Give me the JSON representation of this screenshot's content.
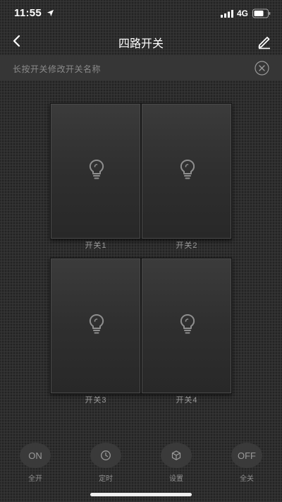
{
  "status_bar": {
    "time": "11:55",
    "network": "4G",
    "icons": [
      "location-arrow-icon",
      "signal-icon",
      "battery-icon"
    ]
  },
  "nav": {
    "title": "四路开关",
    "back_icon": "chevron-left-icon",
    "edit_icon": "pencil-icon"
  },
  "hint": {
    "text": "长按开关修改开关名称",
    "close_icon": "close-circle-icon"
  },
  "switches": [
    {
      "label": "开关1",
      "icon": "bulb-icon"
    },
    {
      "label": "开关2",
      "icon": "bulb-icon"
    },
    {
      "label": "开关3",
      "icon": "bulb-icon"
    },
    {
      "label": "开关4",
      "icon": "bulb-icon"
    }
  ],
  "toolbar": [
    {
      "icon_text": "ON",
      "label": "全开"
    },
    {
      "icon": "clock-icon",
      "label": "定时"
    },
    {
      "icon": "cube-icon",
      "label": "设置"
    },
    {
      "icon_text": "OFF",
      "label": "全关"
    }
  ],
  "colors": {
    "background": "#2e2e2e",
    "hint_bar": "#363636",
    "text_muted": "#8a8a8a"
  }
}
